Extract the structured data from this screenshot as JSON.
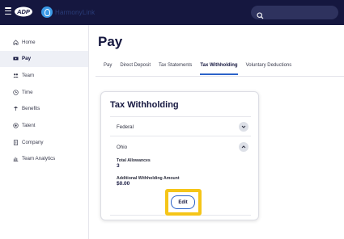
{
  "topbar": {
    "brand_name": "HarmonyLink",
    "search": {
      "placeholder": "",
      "value": ""
    }
  },
  "sidebar": {
    "items": [
      {
        "label": "Home",
        "icon": "home-icon",
        "active": false
      },
      {
        "label": "Pay",
        "icon": "pay-icon",
        "active": true
      },
      {
        "label": "Team",
        "icon": "team-icon",
        "active": false
      },
      {
        "label": "Time",
        "icon": "clock-icon",
        "active": false
      },
      {
        "label": "Benefits",
        "icon": "benefits-icon",
        "active": false
      },
      {
        "label": "Talent",
        "icon": "talent-icon",
        "active": false
      },
      {
        "label": "Company",
        "icon": "company-icon",
        "active": false
      },
      {
        "label": "Team Analytics",
        "icon": "analytics-icon",
        "active": false
      }
    ]
  },
  "main": {
    "title": "Pay",
    "tabs": [
      {
        "label": "Pay",
        "active": false
      },
      {
        "label": "Direct Deposit",
        "active": false
      },
      {
        "label": "Tax Statements",
        "active": false
      },
      {
        "label": "Tax Withholding",
        "active": true
      },
      {
        "label": "Voluntary Deductions",
        "active": false
      }
    ]
  },
  "card": {
    "title": "Tax Withholding",
    "federal_label": "Federal",
    "state_label": "Ohio",
    "allowances_label": "Total Allowances",
    "allowances_value": "3",
    "additional_label": "Additional Withholding Amount",
    "additional_value": "$0.00",
    "edit_label": "Edit"
  },
  "colors": {
    "topbar": "#15173f",
    "accent": "#2b62c9",
    "highlight": "#f5c518"
  }
}
